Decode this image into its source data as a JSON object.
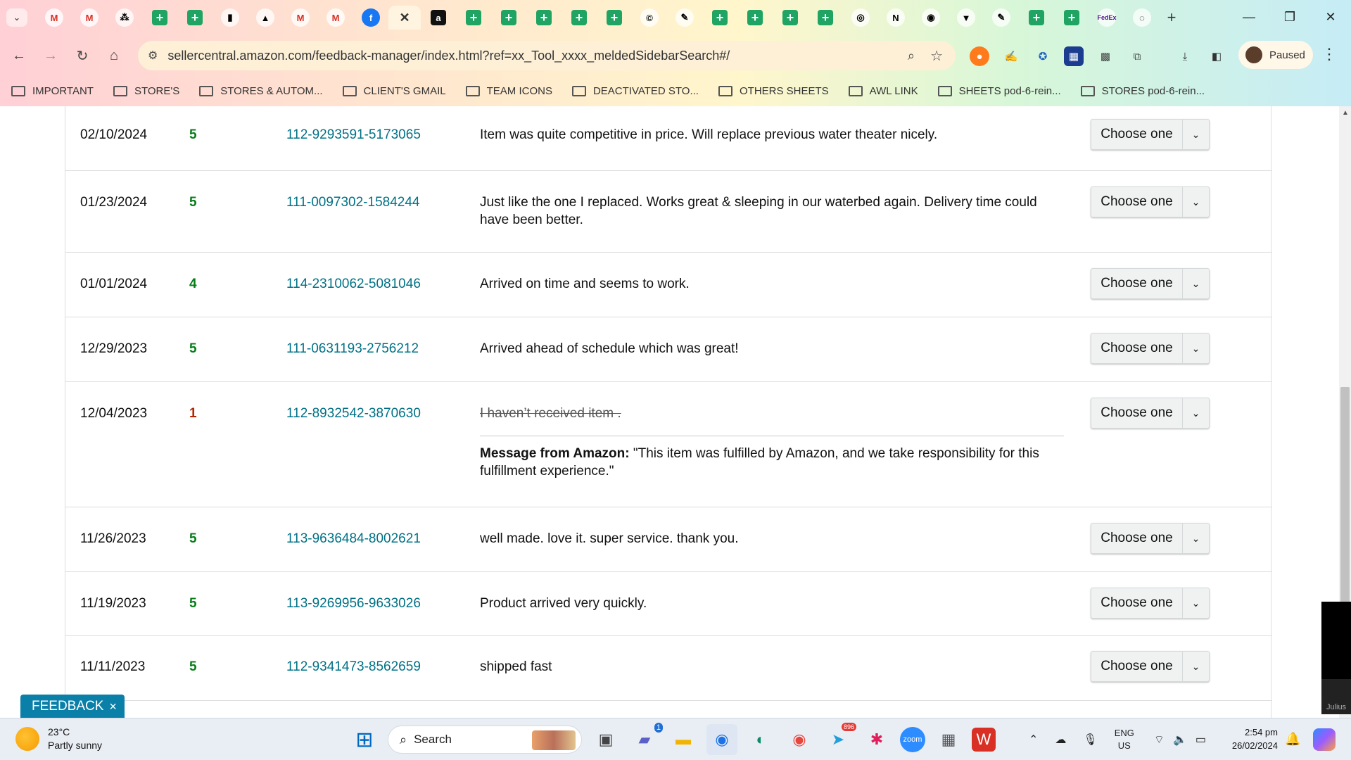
{
  "browser": {
    "tabs": [
      {
        "icon": "gmail-icon",
        "glyph": "M"
      },
      {
        "icon": "gmail-icon",
        "glyph": "M"
      },
      {
        "icon": "asana-icon",
        "glyph": "⁂"
      },
      {
        "icon": "sheets-icon",
        "glyph": "+"
      },
      {
        "icon": "sheets-icon",
        "glyph": "+"
      },
      {
        "icon": "black-square-icon",
        "glyph": "▮"
      },
      {
        "icon": "drive-icon",
        "glyph": "▲"
      },
      {
        "icon": "gmail-icon",
        "glyph": "M"
      },
      {
        "icon": "gmail-icon",
        "glyph": "M"
      },
      {
        "icon": "facebook-icon",
        "glyph": "f"
      },
      {
        "icon": "close-icon",
        "glyph": "✕",
        "active": true
      },
      {
        "icon": "amazon-icon",
        "glyph": "a"
      },
      {
        "icon": "sheets-icon",
        "glyph": "+"
      },
      {
        "icon": "sheets-icon",
        "glyph": "+"
      },
      {
        "icon": "sheets-icon",
        "glyph": "+"
      },
      {
        "icon": "sheets-icon",
        "glyph": "+"
      },
      {
        "icon": "sheets-icon",
        "glyph": "+"
      },
      {
        "icon": "c-circle-icon",
        "glyph": "©"
      },
      {
        "icon": "feather-icon",
        "glyph": "✎"
      },
      {
        "icon": "sheets-icon",
        "glyph": "+"
      },
      {
        "icon": "sheets-icon",
        "glyph": "+"
      },
      {
        "icon": "sheets-icon",
        "glyph": "+"
      },
      {
        "icon": "sheets-icon",
        "glyph": "+"
      },
      {
        "icon": "chat-icon",
        "glyph": "◎"
      },
      {
        "icon": "n-logo-icon",
        "glyph": "N"
      },
      {
        "icon": "nrs-icon",
        "glyph": "◉"
      },
      {
        "icon": "shield-icon",
        "glyph": "▼"
      },
      {
        "icon": "feather-icon",
        "glyph": "✎"
      },
      {
        "icon": "sheets-icon",
        "glyph": "+"
      },
      {
        "icon": "sheets-icon",
        "glyph": "+"
      },
      {
        "icon": "fedex-icon",
        "glyph": "FedEx"
      },
      {
        "icon": "globe-icon",
        "glyph": "◌"
      }
    ],
    "url": "sellercentral.amazon.com/feedback-manager/index.html?ref=xx_Tool_xxxx_meldedSidebarSearch#/",
    "profile_label": "Paused",
    "bookmarks": [
      "IMPORTANT",
      "STORE'S",
      "STORES & AUTOM...",
      "CLIENT'S GMAIL",
      "TEAM ICONS",
      "DEACTIVATED STO...",
      "OTHERS SHEETS",
      "AWL LINK",
      "SHEETS pod-6-rein...",
      "STORES pod-6-rein..."
    ]
  },
  "feedback_rows": [
    {
      "date": "02/10/2024",
      "rating": "5",
      "order": "112-9293591-5173065",
      "comment": "Item was quite competitive in price. Will replace previous water theater nicely.",
      "action": "Choose one"
    },
    {
      "date": "01/23/2024",
      "rating": "5",
      "order": "111-0097302-1584244",
      "comment": "Just like the one I replaced. Works great & sleeping in our waterbed again. Delivery time could have been better.",
      "action": "Choose one"
    },
    {
      "date": "01/01/2024",
      "rating": "4",
      "order": "114-2310062-5081046",
      "comment": "Arrived on time and seems to work.",
      "action": "Choose one"
    },
    {
      "date": "12/29/2023",
      "rating": "5",
      "order": "111-0631193-2756212",
      "comment": "Arrived ahead of schedule which was great!",
      "action": "Choose one"
    },
    {
      "date": "12/04/2023",
      "rating": "1",
      "order": "112-8932542-3870630",
      "comment": "I haven’t received item .",
      "action": "Choose one",
      "struck": true,
      "amazon_message_label": "Message from Amazon:",
      "amazon_message": "\"This item was fulfilled by Amazon, and we take responsibility for this fulfillment experience.\""
    },
    {
      "date": "11/26/2023",
      "rating": "5",
      "order": "113-9636484-8002621",
      "comment": "well made. love it. super service. thank you.",
      "action": "Choose one"
    },
    {
      "date": "11/19/2023",
      "rating": "5",
      "order": "113-9269956-9633026",
      "comment": "Product arrived very quickly.",
      "action": "Choose one"
    },
    {
      "date": "11/11/2023",
      "rating": "5",
      "order": "112-9341473-8562659",
      "comment": "shipped fast",
      "action": "Choose one"
    }
  ],
  "feedback_button": {
    "label": "FEEDBACK",
    "close": "×"
  },
  "julius_label": "Julius",
  "taskbar": {
    "temp": "23°C",
    "condition": "Partly sunny",
    "search_label": "Search",
    "teams_badge": "1",
    "telegram_badge": "896",
    "lang_line1": "ENG",
    "lang_line2": "US",
    "time": "2:54 pm",
    "date": "26/02/2024"
  },
  "colors": {
    "link": "#007185",
    "rating_good": "#067d18",
    "rating_bad": "#b12704",
    "feedback_button": "#0a7fa8"
  }
}
